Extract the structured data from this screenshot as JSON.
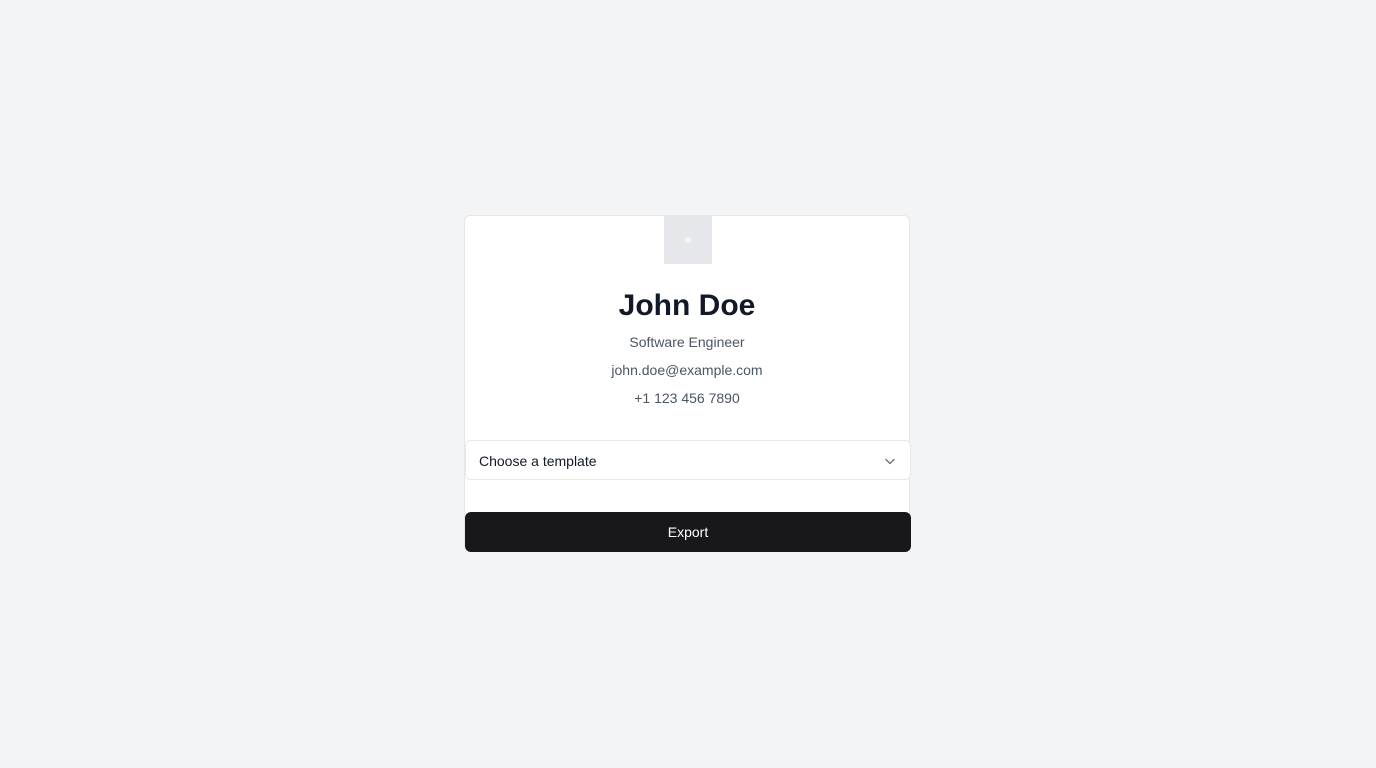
{
  "profile": {
    "name": "John Doe",
    "role": "Software Engineer",
    "email": "john.doe@example.com",
    "phone": "+1 123 456 7890",
    "avatar_icon": "image-placeholder-icon"
  },
  "template_select": {
    "placeholder": "Choose a template",
    "icon": "chevron-down-icon"
  },
  "actions": {
    "export_label": "Export"
  },
  "colors": {
    "page_background": "#f3f4f6",
    "card_background": "#ffffff",
    "primary_button": "#18181b",
    "heading_text": "#111827",
    "muted_text": "#4b5563"
  }
}
